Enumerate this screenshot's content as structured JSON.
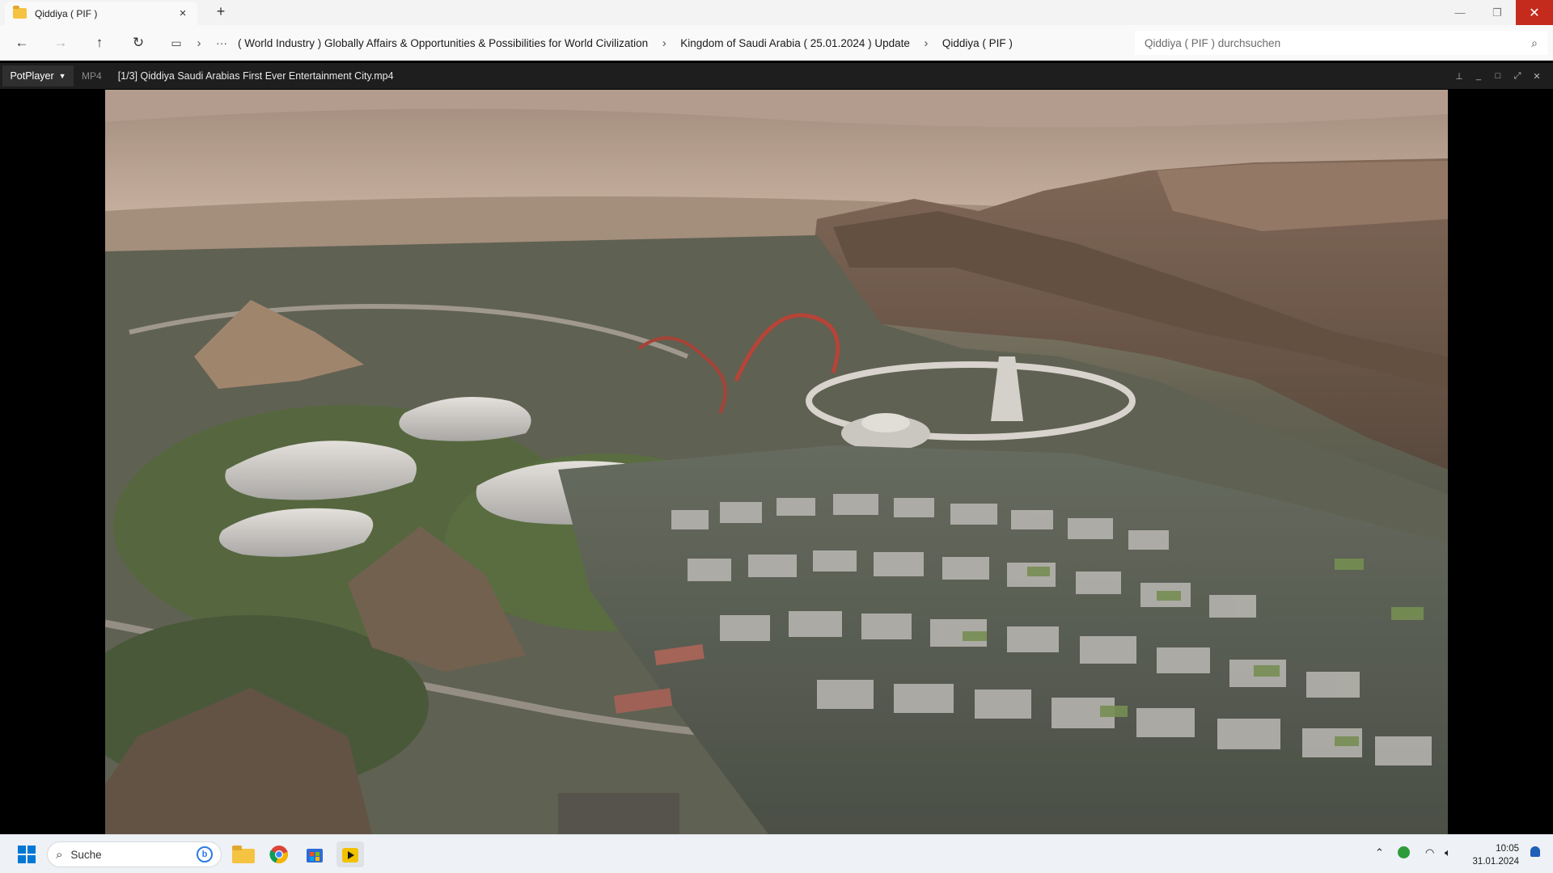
{
  "explorer": {
    "tab_title": "Qiddiya ( PIF )",
    "breadcrumbs": [
      "( World Industry ) Globally Affairs & Opportunities & Possibilities for World Civilization",
      "Kingdom of Saudi Arabia ( 25.01.2024 ) Update",
      "Qiddiya ( PIF )"
    ],
    "search_placeholder": "Qiddiya ( PIF ) durchsuchen",
    "icons": {
      "back": "back-arrow-icon",
      "forward": "forward-arrow-icon",
      "up": "up-arrow-icon",
      "refresh": "refresh-icon"
    }
  },
  "player": {
    "brand": "PotPlayer",
    "format": "MP4",
    "file_title": "[1/3] Qiddiya  Saudi Arabias First Ever Entertainment City.mp4"
  },
  "taskbar": {
    "search_label": "Suche",
    "time": "10:05",
    "date": "31.01.2024",
    "pinned": [
      "windows-start-icon",
      "file-explorer-icon",
      "chrome-icon",
      "microsoft-store-icon",
      "potplayer-icon"
    ]
  },
  "colors": {
    "close_red": "#c42b1c",
    "folder_yellow": "#f5c342",
    "player_bar": "#1e1e1e"
  }
}
